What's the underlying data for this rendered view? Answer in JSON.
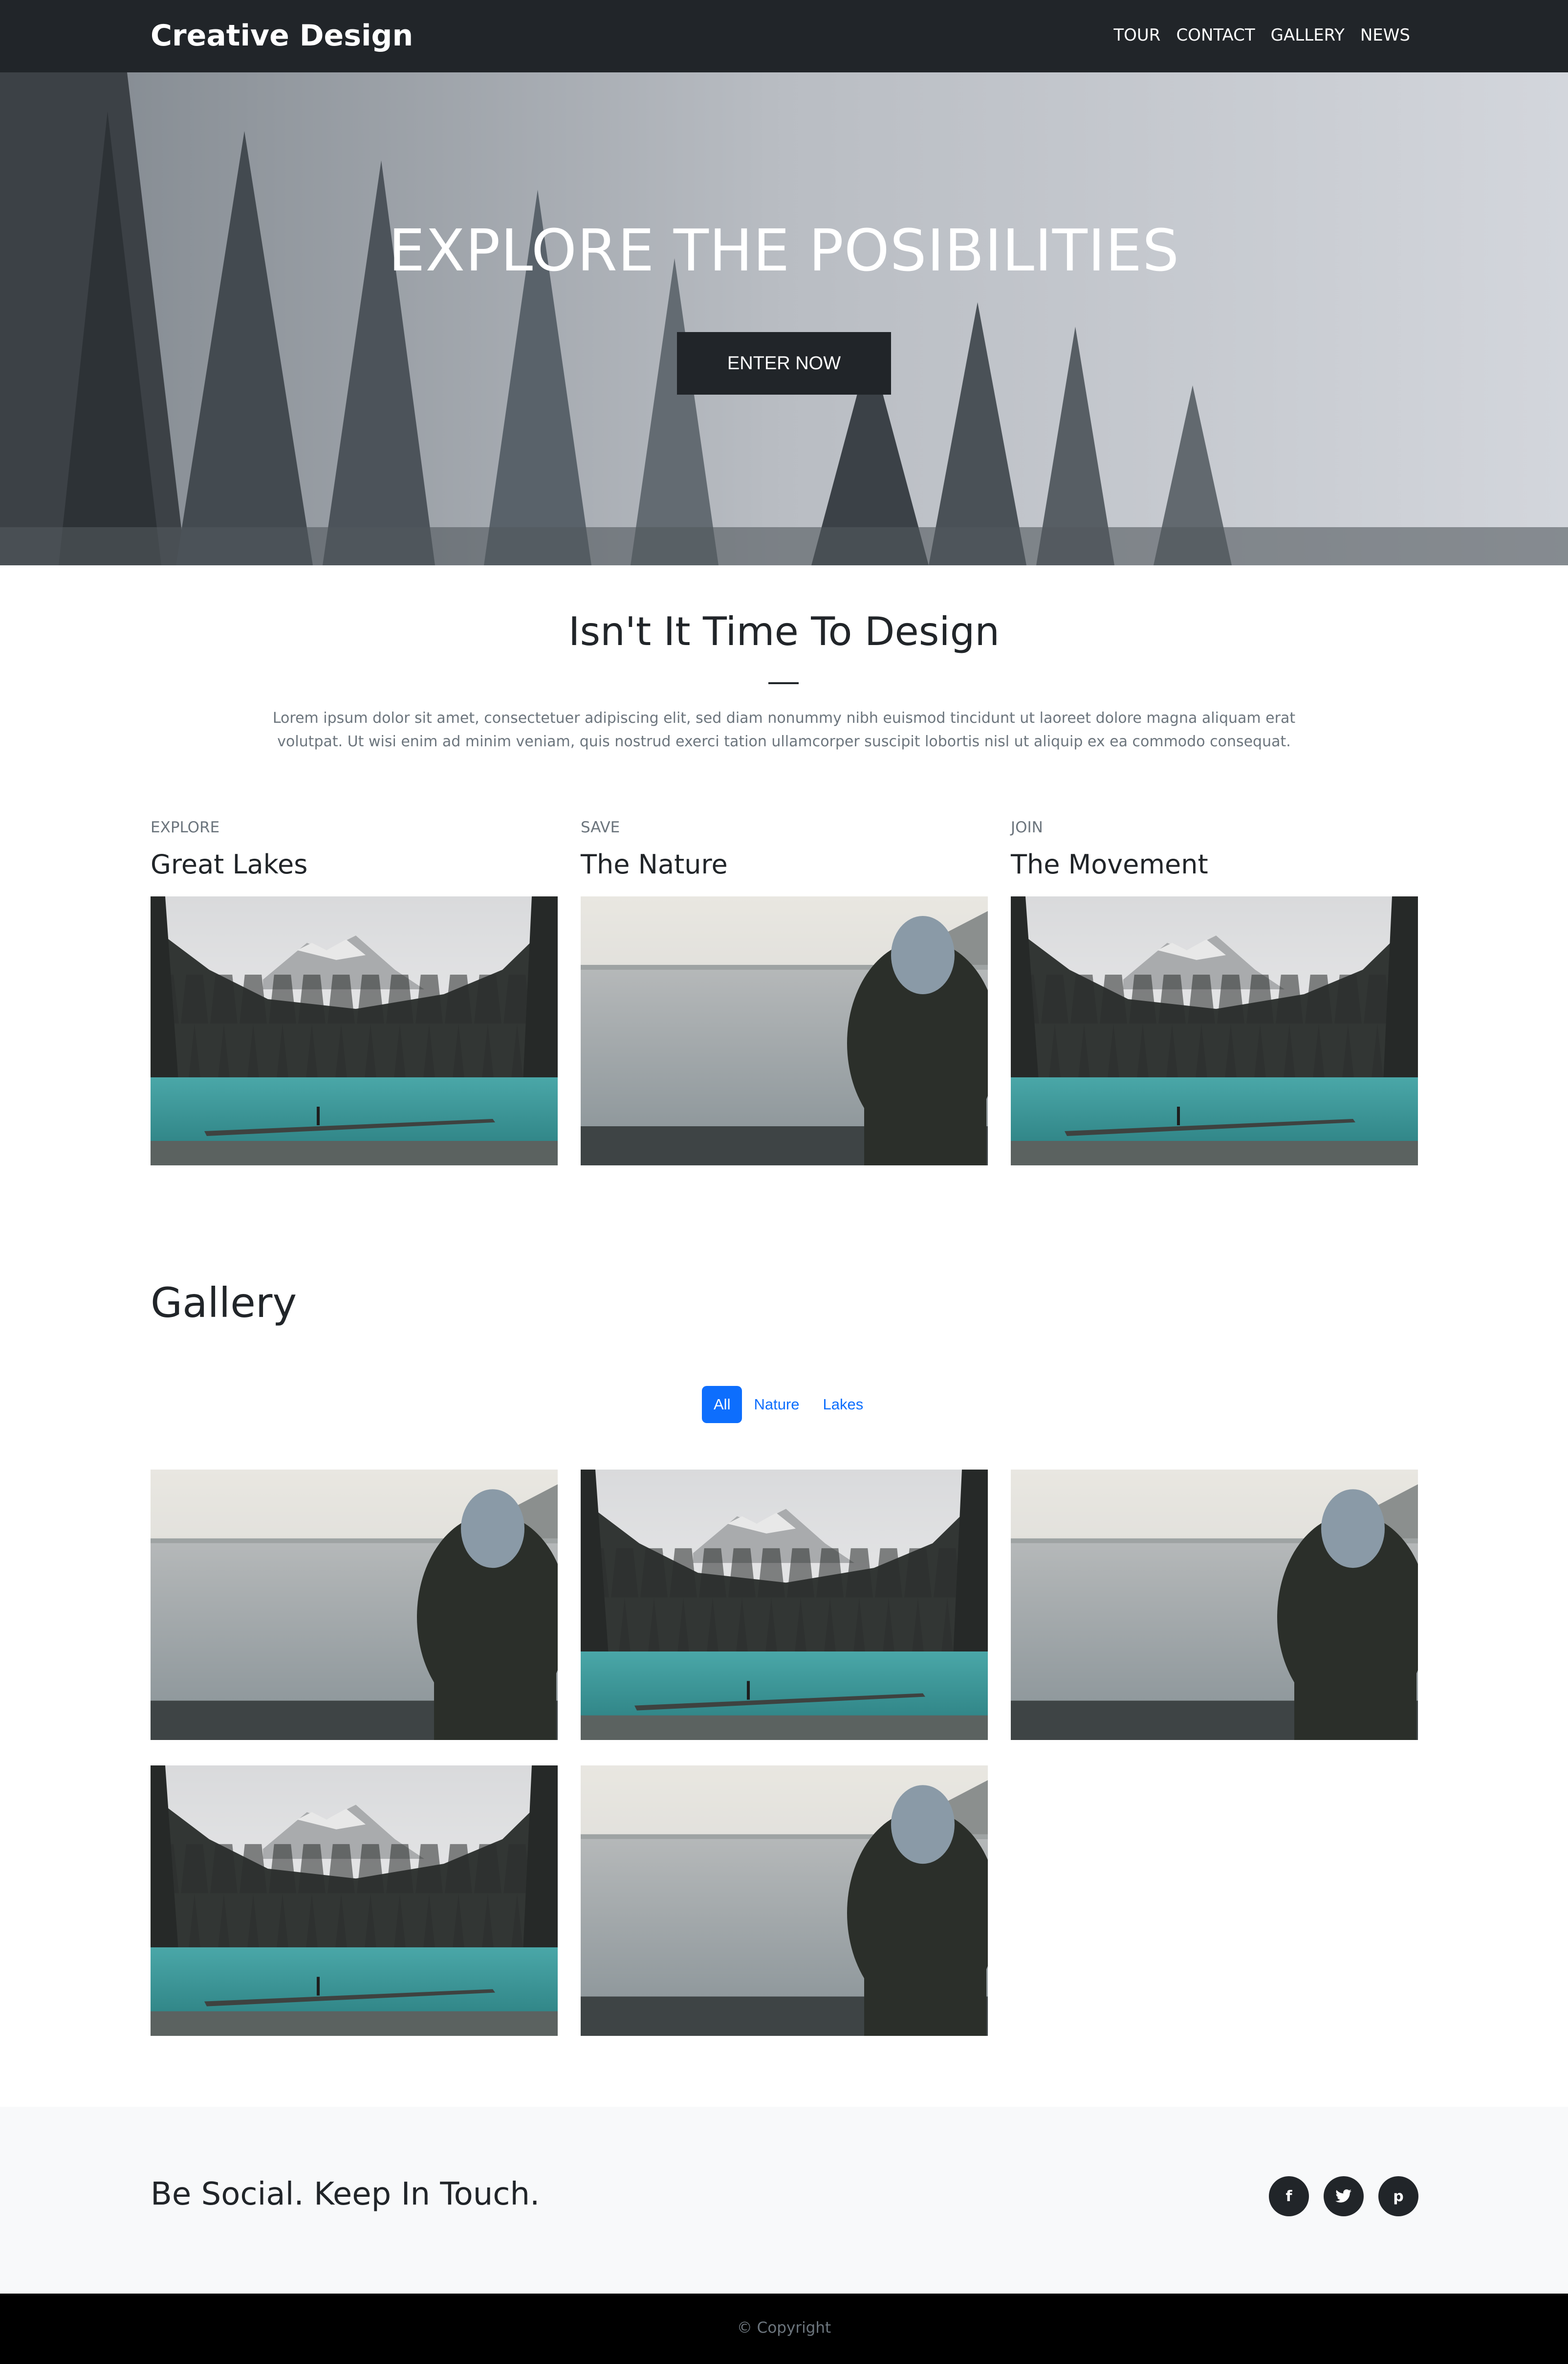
{
  "navbar": {
    "brand": "Creative Design",
    "links": [
      "TOUR",
      "CONTACT",
      "GALLERY",
      "NEWS"
    ]
  },
  "hero": {
    "title": "EXPLORE THE POSIBILITIES",
    "button_label": "ENTER NOW"
  },
  "intro": {
    "heading": "Isn't It Time To Design",
    "text": "Lorem ipsum dolor sit amet, consectetuer adipiscing elit, sed diam nonummy nibh euismod tincidunt ut laoreet dolore magna aliquam erat volutpat. Ut wisi enim ad minim veniam, quis nostrud exerci tation ullamcorper suscipit lobortis nisl ut aliquip ex ea commodo consequat."
  },
  "features": [
    {
      "eyebrow": "EXPLORE",
      "title": "Great Lakes",
      "image": "lake"
    },
    {
      "eyebrow": "SAVE",
      "title": "The Nature",
      "image": "hooded-person"
    },
    {
      "eyebrow": "JOIN",
      "title": "The Movement",
      "image": "lake"
    }
  ],
  "gallery": {
    "heading": "Gallery",
    "filters": [
      "All",
      "Nature",
      "Lakes"
    ],
    "active_filter": "All",
    "items": [
      "hooded-person",
      "lake",
      "hooded-person",
      "lake",
      "hooded-person"
    ]
  },
  "social": {
    "title": "Be Social. Keep In Touch.",
    "icons": [
      "facebook-icon",
      "twitter-icon",
      "pinterest-icon"
    ]
  },
  "footer": {
    "copyright": "© Copyright"
  },
  "colors": {
    "dark": "#212529",
    "primary": "#0d6efd",
    "muted": "#6c757d",
    "light_bg": "#f8f9fa",
    "lake_teal": "#3b9a9c"
  }
}
